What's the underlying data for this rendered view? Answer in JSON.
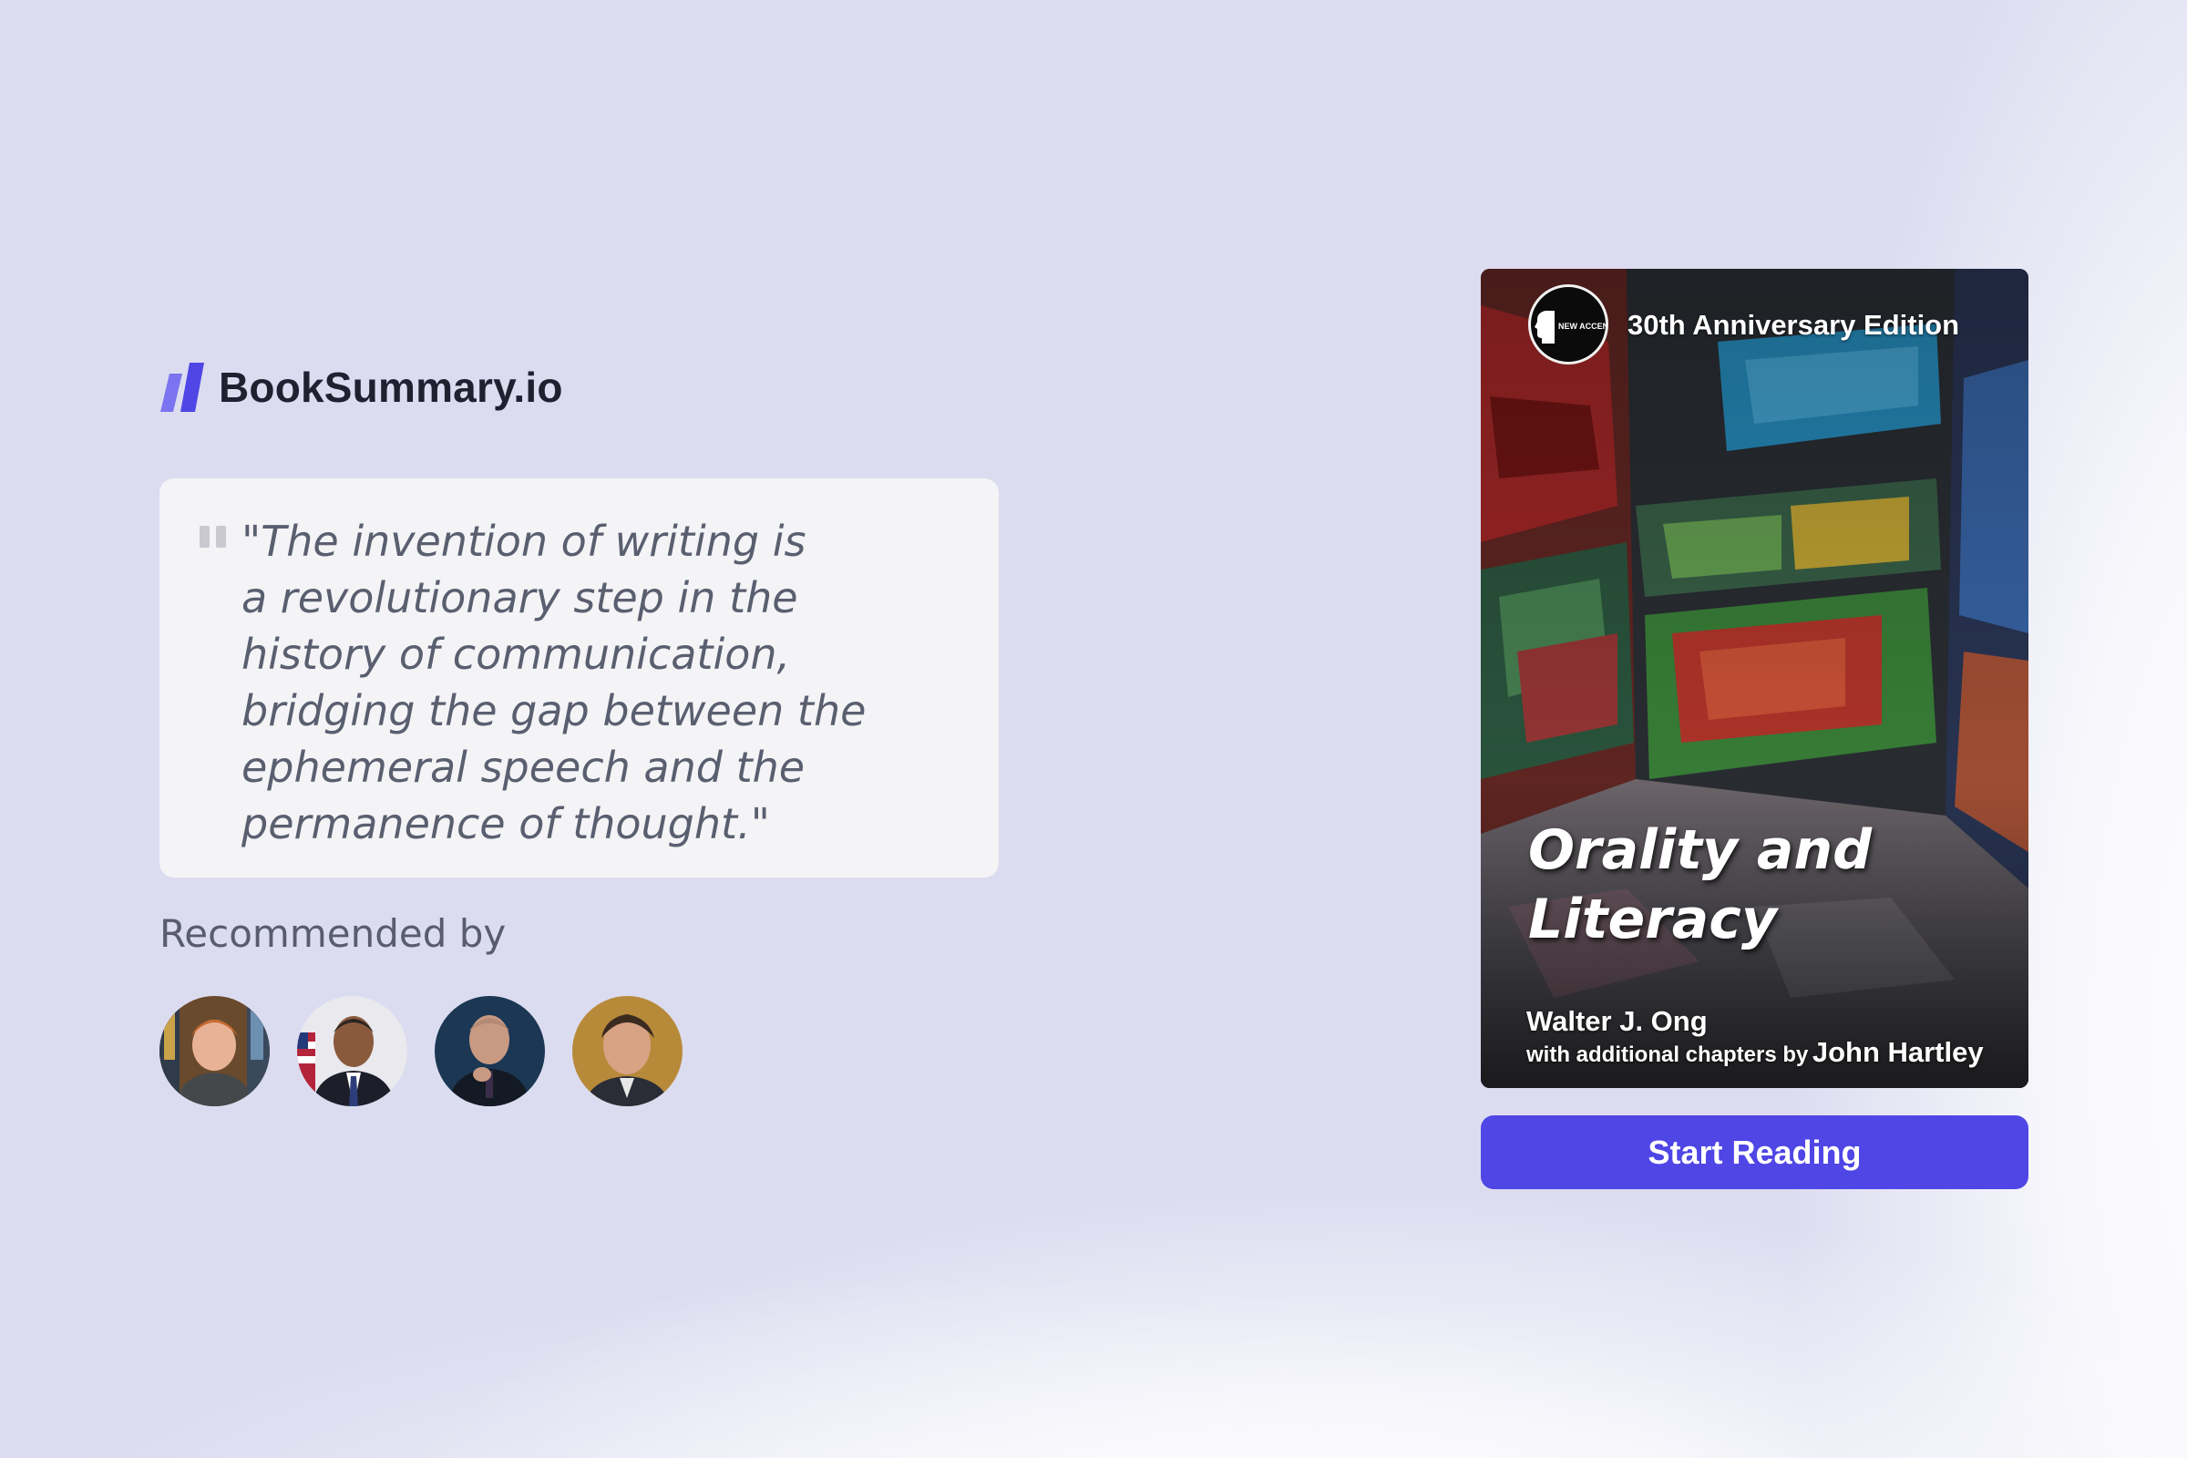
{
  "brand": {
    "name": "BookSummary.io",
    "icon": "slanted-bars-logo-icon",
    "accent_color": "#4f46e5"
  },
  "quote": {
    "icon": "quote-mark-icon",
    "text": "\"The invention of writing is\na revolutionary step in the\nhistory of communication,\nbridging the gap between the\nephemeral speech and the\npermanence of thought.\""
  },
  "recommended": {
    "label": "Recommended by",
    "avatars": [
      {
        "icon": "avatar-photo-1"
      },
      {
        "icon": "avatar-photo-2"
      },
      {
        "icon": "avatar-photo-3"
      },
      {
        "icon": "avatar-photo-4"
      }
    ]
  },
  "book": {
    "series_badge": "NEW ACCENTS",
    "edition": "30th Anniversary Edition",
    "title": "Orality and\nLiteracy",
    "author": "Walter J. Ong",
    "additional_prefix": "with additional chapters by",
    "coauthor": "John Hartley",
    "cover_art": "graffiti-room-image"
  },
  "cta": {
    "label": "Start Reading",
    "color": "#4f46e5"
  }
}
